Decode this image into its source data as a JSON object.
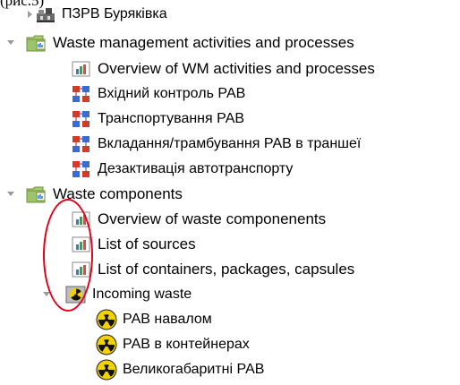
{
  "caption": "(рис.5)",
  "colors": {
    "annotation": "#e0001a",
    "folder": "#8fbc5a",
    "chart_bars": [
      "#2f7fd3",
      "#2aa84a",
      "#e24a3a"
    ],
    "radiation": "#f2d200",
    "process_blocks": [
      "#d23a2a",
      "#3a6ad3"
    ]
  },
  "tree": {
    "items": [
      {
        "label": "ПЗРВ Буряківка",
        "icon": "facility-icon",
        "expander": "collapsed"
      },
      {
        "label": "Waste management activities and processes",
        "icon": "folder-icon",
        "expander": "expanded"
      },
      {
        "label": "Overview of WM activities and processes",
        "icon": "chart-icon"
      },
      {
        "label": "Вхідний контроль РАВ",
        "icon": "process-icon"
      },
      {
        "label": "Транспортування РАВ",
        "icon": "process-icon"
      },
      {
        "label": "Вкладання/трамбування РАВ в траншеї",
        "icon": "process-icon"
      },
      {
        "label": "Дезактивація автотранспорту",
        "icon": "process-icon"
      },
      {
        "label": "Waste components",
        "icon": "folder-icon",
        "expander": "expanded"
      },
      {
        "label": "Overview of waste componenents",
        "icon": "chart-icon"
      },
      {
        "label": "List of sources",
        "icon": "chart-icon"
      },
      {
        "label": "List of containers, packages, capsules",
        "icon": "chart-icon"
      },
      {
        "label": "Incoming waste",
        "icon": "radiation-icon",
        "expander": "expanded"
      },
      {
        "label": "РАВ навалом",
        "icon": "radiation-icon"
      },
      {
        "label": "РАВ в контейнерах",
        "icon": "radiation-icon"
      },
      {
        "label": "Великогабаритні РАВ",
        "icon": "radiation-icon"
      }
    ]
  }
}
